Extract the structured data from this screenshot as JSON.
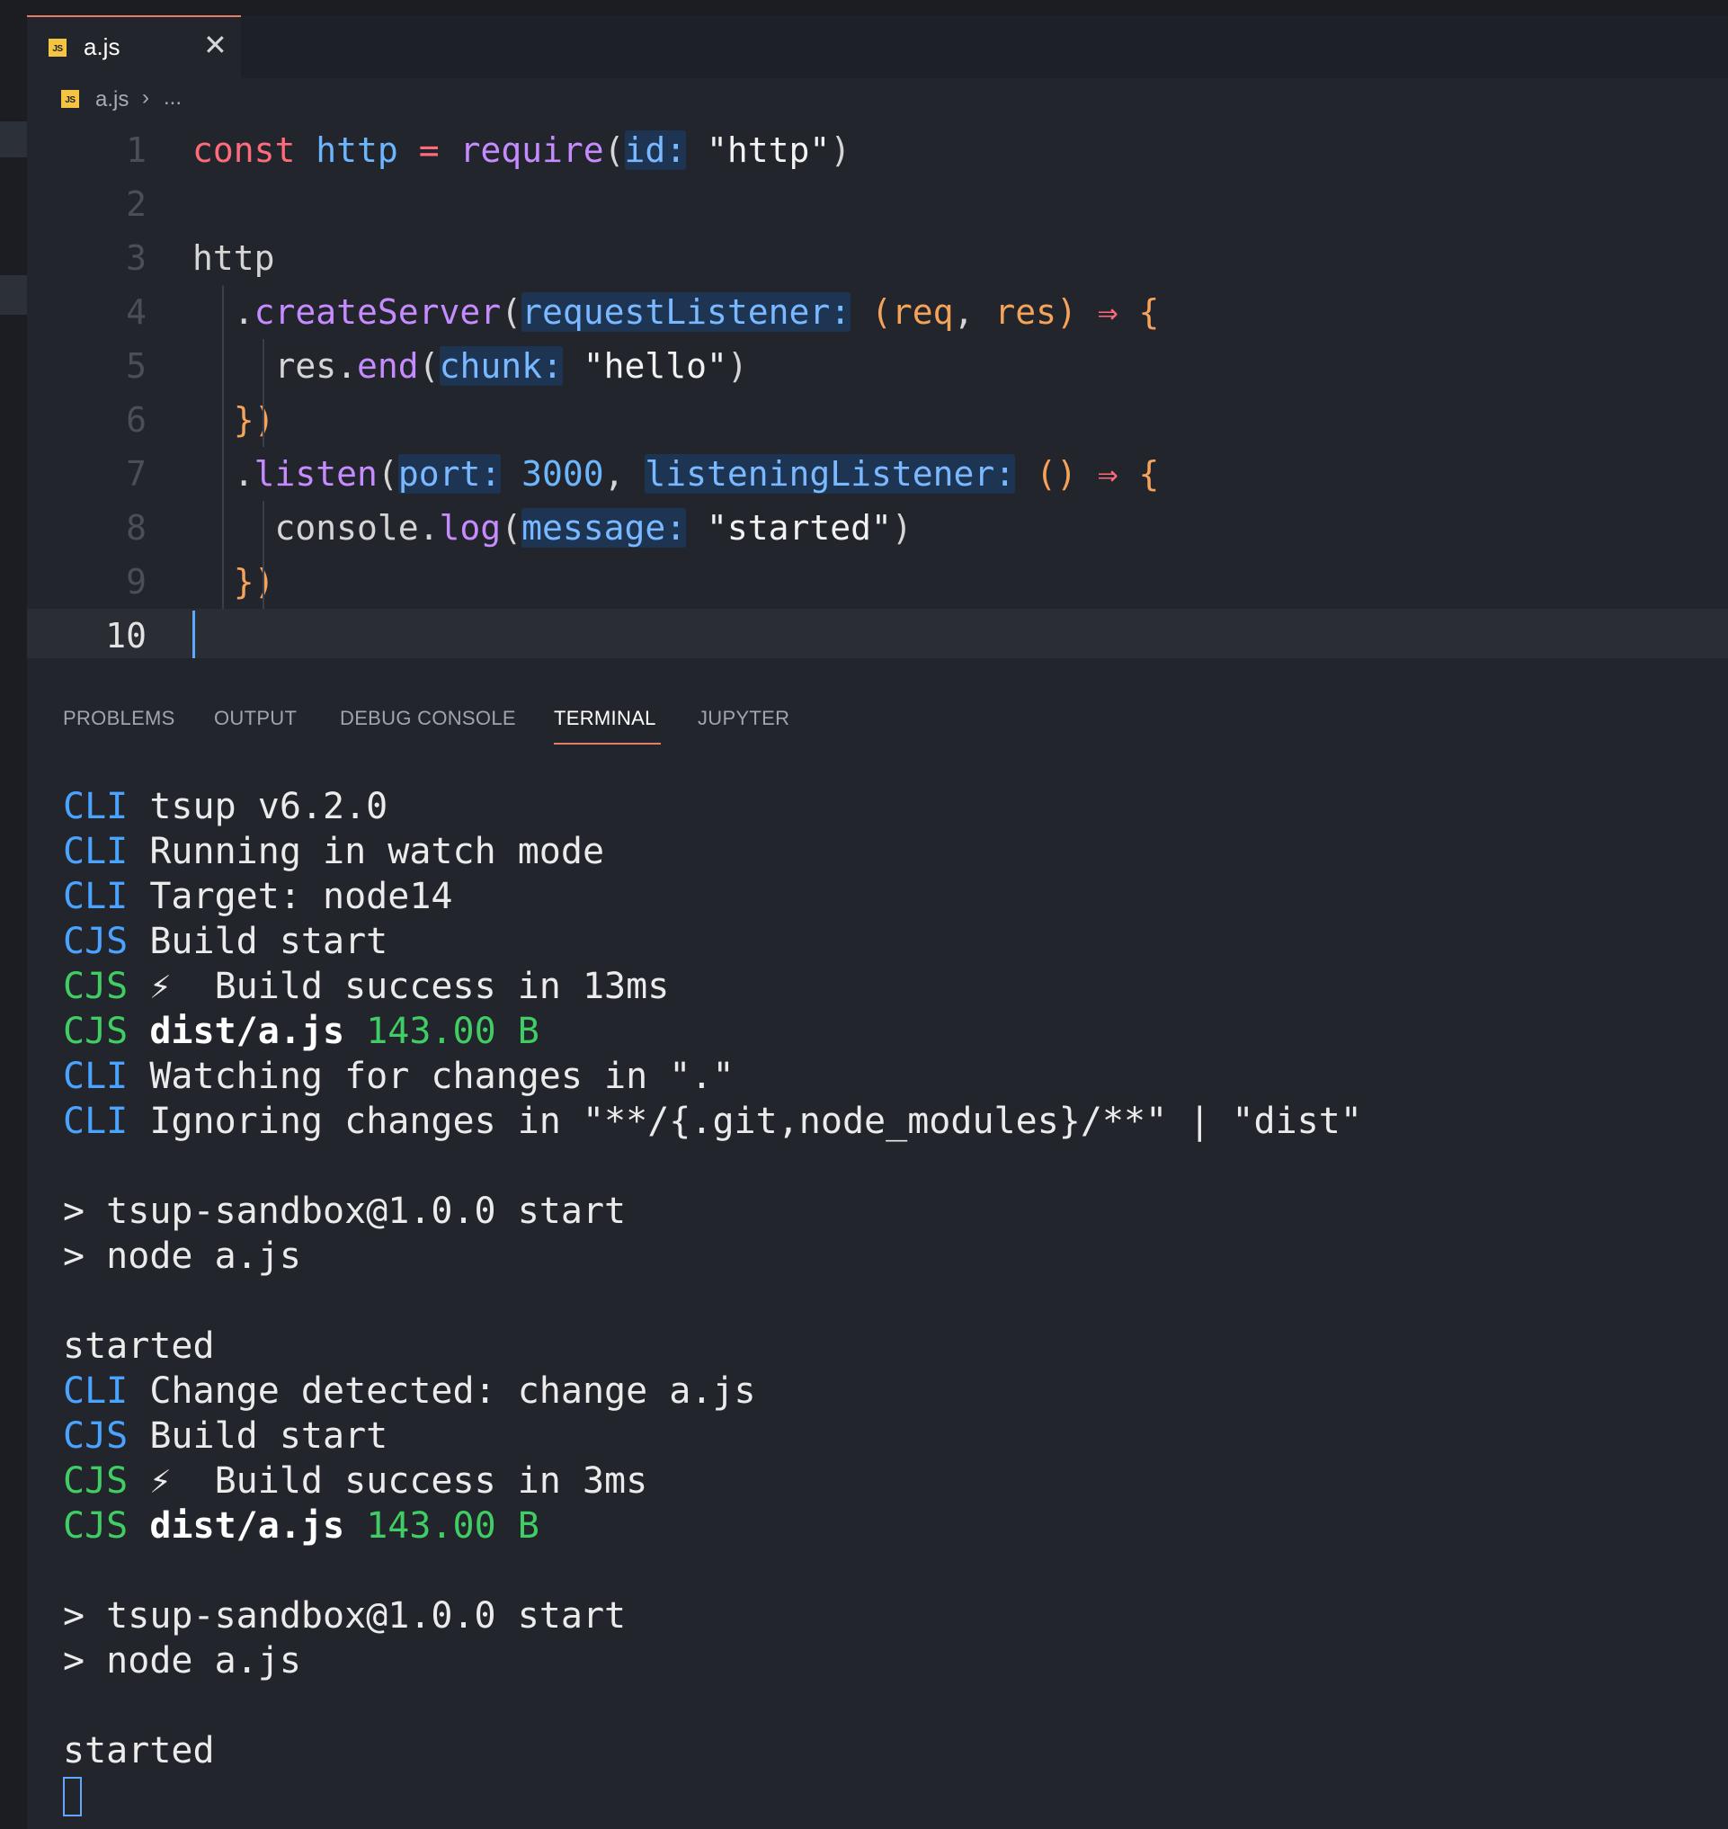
{
  "tab": {
    "badge": "JS",
    "label": "a.js",
    "close": "✕"
  },
  "breadcrumb": {
    "badge": "JS",
    "file": "a.js",
    "separator": "›",
    "more": "..."
  },
  "editor": {
    "line_numbers": [
      "1",
      "2",
      "3",
      "4",
      "5",
      "6",
      "7",
      "8",
      "9",
      "10"
    ],
    "current_line": "10",
    "lines": [
      [
        [
          "kw",
          "const"
        ],
        [
          "pn",
          " "
        ],
        [
          "var",
          "http"
        ],
        [
          "pn",
          " "
        ],
        [
          "op",
          "="
        ],
        [
          "pn",
          " "
        ],
        [
          "fn",
          "require"
        ],
        [
          "pn",
          "("
        ],
        [
          "inlay",
          "id:"
        ],
        [
          "pn",
          " "
        ],
        [
          "str",
          "\"http\""
        ],
        [
          "pn",
          ")"
        ]
      ],
      [],
      [
        [
          "pn",
          "http"
        ]
      ],
      [
        [
          "pn",
          "  ."
        ],
        [
          "fn",
          "createServer"
        ],
        [
          "pn",
          "("
        ],
        [
          "inlay",
          "requestListener:"
        ],
        [
          "pn",
          " "
        ],
        [
          "brace",
          "("
        ],
        [
          "param",
          "req"
        ],
        [
          "pn",
          ", "
        ],
        [
          "param",
          "res"
        ],
        [
          "brace",
          ")"
        ],
        [
          "pn",
          " "
        ],
        [
          "op",
          "⇒"
        ],
        [
          "pn",
          " "
        ],
        [
          "brace",
          "{"
        ]
      ],
      [
        [
          "pn",
          "    res."
        ],
        [
          "fn",
          "end"
        ],
        [
          "pn",
          "("
        ],
        [
          "inlay",
          "chunk:"
        ],
        [
          "pn",
          " "
        ],
        [
          "str",
          "\"hello\""
        ],
        [
          "pn",
          ")"
        ]
      ],
      [
        [
          "brace",
          "  })"
        ]
      ],
      [
        [
          "pn",
          "  ."
        ],
        [
          "fn",
          "listen"
        ],
        [
          "pn",
          "("
        ],
        [
          "inlay",
          "port:"
        ],
        [
          "pn",
          " "
        ],
        [
          "num",
          "3000"
        ],
        [
          "pn",
          ", "
        ],
        [
          "inlay",
          "listeningListener:"
        ],
        [
          "pn",
          " "
        ],
        [
          "brace",
          "()"
        ],
        [
          "pn",
          " "
        ],
        [
          "op",
          "⇒"
        ],
        [
          "pn",
          " "
        ],
        [
          "brace",
          "{"
        ]
      ],
      [
        [
          "pn",
          "    console."
        ],
        [
          "fn",
          "log"
        ],
        [
          "pn",
          "("
        ],
        [
          "inlay",
          "message:"
        ],
        [
          "pn",
          " "
        ],
        [
          "str",
          "\"started\""
        ],
        [
          "pn",
          ")"
        ]
      ],
      [
        [
          "brace",
          "  })"
        ]
      ],
      []
    ]
  },
  "panel": {
    "tabs": [
      "PROBLEMS",
      "OUTPUT",
      "DEBUG CONSOLE",
      "TERMINAL",
      "JUPYTER"
    ],
    "active_tab": "TERMINAL"
  },
  "terminal": {
    "lines": [
      [
        [
          "tblue",
          "CLI"
        ],
        [
          "t",
          " tsup v6.2.0"
        ]
      ],
      [
        [
          "tblue",
          "CLI"
        ],
        [
          "t",
          " Running in watch mode"
        ]
      ],
      [
        [
          "tblue",
          "CLI"
        ],
        [
          "t",
          " Target: node14"
        ]
      ],
      [
        [
          "tblue",
          "CJS"
        ],
        [
          "t",
          " Build start"
        ]
      ],
      [
        [
          "tgreen",
          "CJS"
        ],
        [
          "t",
          " ⚡  Build success in 13ms"
        ]
      ],
      [
        [
          "tgreen",
          "CJS"
        ],
        [
          "t",
          " "
        ],
        [
          "tbold",
          "dist/a.js"
        ],
        [
          "t",
          " "
        ],
        [
          "tgreen",
          "143.00 B"
        ]
      ],
      [
        [
          "tblue",
          "CLI"
        ],
        [
          "t",
          " Watching for changes in \".\""
        ]
      ],
      [
        [
          "tblue",
          "CLI"
        ],
        [
          "t",
          " Ignoring changes in \"**/{.git,node_modules}/**\" | \"dist\""
        ]
      ],
      [],
      [
        [
          "t",
          "> tsup-sandbox@1.0.0 start"
        ]
      ],
      [
        [
          "t",
          "> node a.js"
        ]
      ],
      [],
      [
        [
          "t",
          "started"
        ]
      ],
      [
        [
          "tblue",
          "CLI"
        ],
        [
          "t",
          " Change detected: change a.js"
        ]
      ],
      [
        [
          "tblue",
          "CJS"
        ],
        [
          "t",
          " Build start"
        ]
      ],
      [
        [
          "tgreen",
          "CJS"
        ],
        [
          "t",
          " ⚡  Build success in 3ms"
        ]
      ],
      [
        [
          "tgreen",
          "CJS"
        ],
        [
          "t",
          " "
        ],
        [
          "tbold",
          "dist/a.js"
        ],
        [
          "t",
          " "
        ],
        [
          "tgreen",
          "143.00 B"
        ]
      ],
      [],
      [
        [
          "t",
          "> tsup-sandbox@1.0.0 start"
        ]
      ],
      [
        [
          "t",
          "> node a.js"
        ]
      ],
      [],
      [
        [
          "t",
          "started"
        ]
      ]
    ]
  },
  "colors": {
    "accent": "#e67e67",
    "keyword": "#ff6b7a",
    "function": "#c58bff",
    "variable": "#6cb6ff",
    "param": "#f5a35a",
    "inlay_bg": "#1d3553",
    "terminal_blue": "#4aa3ff",
    "terminal_green": "#3fcd64"
  }
}
